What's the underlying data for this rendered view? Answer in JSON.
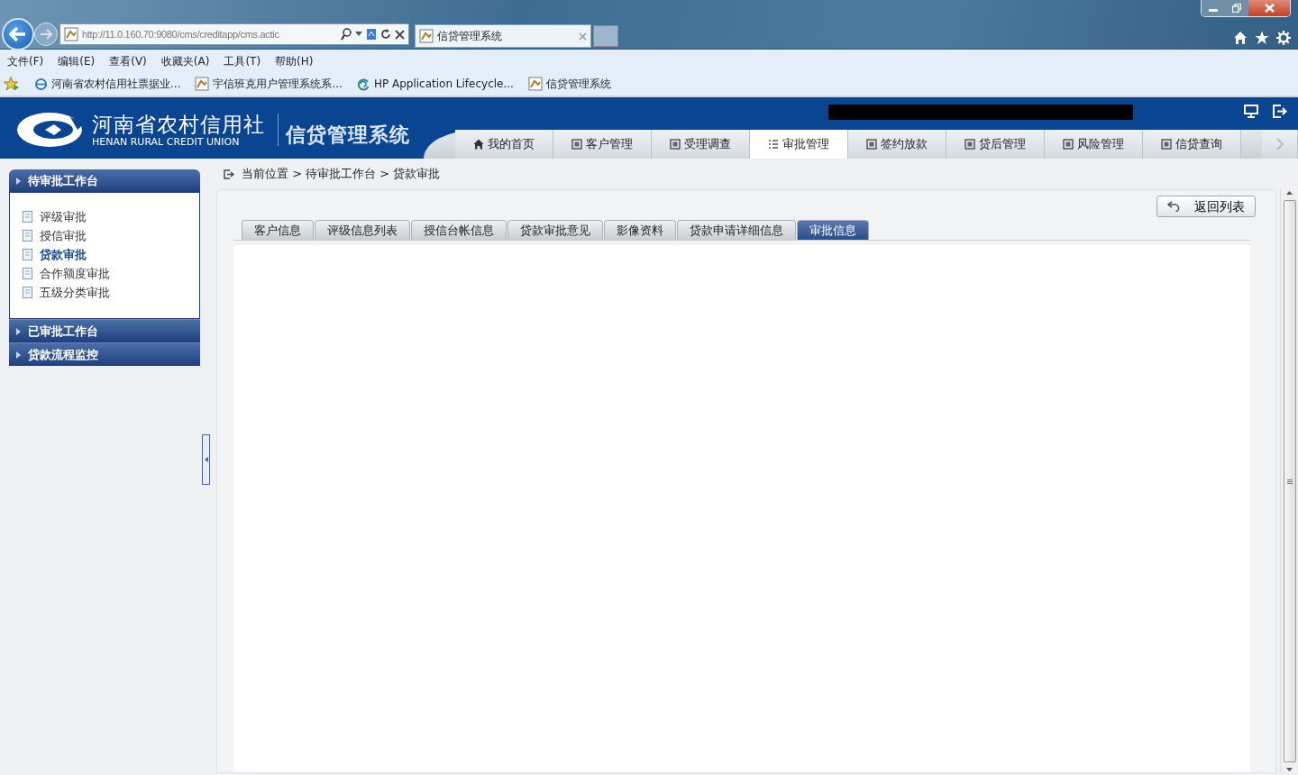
{
  "browser": {
    "url": "http://11.0.160.70:9080/cms/creditapp/cms.actic",
    "tab_title": "信贷管理系统"
  },
  "menu": [
    "文件(F)",
    "编辑(E)",
    "查看(V)",
    "收藏夹(A)",
    "工具(T)",
    "帮助(H)"
  ],
  "favorites": [
    {
      "label": "河南省农村信用社票据业..."
    },
    {
      "label": "宇信班克用户管理系统系..."
    },
    {
      "label": "HP Application Lifecycle..."
    },
    {
      "label": "信贷管理系统"
    }
  ],
  "app": {
    "org_name": "河南省农村信用社",
    "org_name_en": "HENAN RURAL CREDIT UNION",
    "system_name": "信贷管理系统"
  },
  "nav_tabs": [
    {
      "label": "我的首页",
      "selected": false
    },
    {
      "label": "客户管理",
      "selected": false
    },
    {
      "label": "受理调查",
      "selected": false
    },
    {
      "label": "审批管理",
      "selected": true
    },
    {
      "label": "签约放款",
      "selected": false
    },
    {
      "label": "贷后管理",
      "selected": false
    },
    {
      "label": "风险管理",
      "selected": false
    },
    {
      "label": "信贷查询",
      "selected": false
    }
  ],
  "sidebar": [
    {
      "title": "待审批工作台",
      "expanded": true,
      "items": [
        {
          "label": "评级审批",
          "selected": false
        },
        {
          "label": "授信审批",
          "selected": false
        },
        {
          "label": "贷款审批",
          "selected": true
        },
        {
          "label": "合作额度审批",
          "selected": false
        },
        {
          "label": "五级分类审批",
          "selected": false
        }
      ]
    },
    {
      "title": "已审批工作台",
      "expanded": false
    },
    {
      "title": "贷款流程监控",
      "expanded": false
    }
  ],
  "breadcrumb": "当前位置 > 待审批工作台 > 贷款审批",
  "return_button": "返回列表",
  "tabs": [
    {
      "label": "客户信息",
      "selected": false
    },
    {
      "label": "评级信息列表",
      "selected": false
    },
    {
      "label": "授信台帐信息",
      "selected": false
    },
    {
      "label": "贷款审批意见",
      "selected": false
    },
    {
      "label": "影像资料",
      "selected": false
    },
    {
      "label": "贷款申请详细信息",
      "selected": false
    },
    {
      "label": "审批信息",
      "selected": true
    }
  ]
}
